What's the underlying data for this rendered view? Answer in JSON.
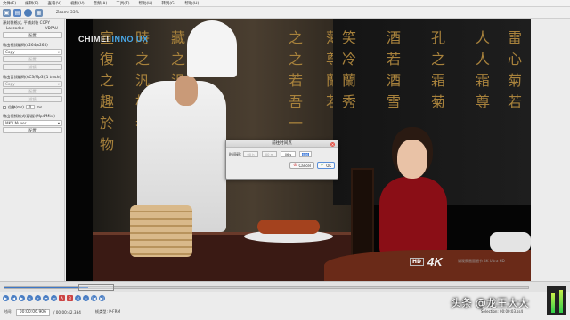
{
  "menu": [
    "文件(F)",
    "编辑(E)",
    "查看(V)",
    "视频(V)",
    "音频(A)",
    "工具(T)",
    "帮助(H)",
    "转到(G)",
    "帮助(H)"
  ],
  "toolbar": {
    "zoom_label": "Zoom: 33%"
  },
  "left_panel": {
    "header1": "源封装格式, 平铺封装 COPY",
    "lavcodec": "Lavcodec",
    "vdpau": "VDPAU",
    "config_btn_1": "配置",
    "video_out_label": "输出视频编码(x264/x265)",
    "video_select": "Copy",
    "config_btn_2": "配置",
    "filter_btn": "滤镜",
    "audio_out_label": "输出音频编码(AC3/Mp3)(1 track(s))",
    "audio_select": "Copy",
    "config_btn_3": "配置",
    "filter_btn_2": "滤镜",
    "shift_label": "位移(ms)",
    "shift_value": "0",
    "shift_unit": "ms",
    "container_label": "输出视频格式(容器)(Mp4/Mkv)",
    "container_select": "MKV Muxer",
    "config_btn_4": "配置"
  },
  "video": {
    "logo_text": "CHIMEI",
    "logo_accent": "INNO UX",
    "hd_badge": "HD",
    "four_k": "4K",
    "caption": "请观察画面细节 4K Ultra HD"
  },
  "dialog": {
    "title": "前往时间点",
    "label": "时间码:",
    "hours": "00 h",
    "minutes": "00 m",
    "seconds": "06 s",
    "millis": "666",
    "cancel": "Cancel",
    "ok": "OK"
  },
  "status": {
    "time_label": "时间:",
    "time_value": "00:00:06.906",
    "total": "/ 00:00:42.334",
    "frame_type": "帧类型: P-FRM",
    "selection": "Selection: 00:00:03.ss4"
  },
  "watermark": "头条 @龙王大大",
  "progress": {
    "fraction": 0.16
  }
}
